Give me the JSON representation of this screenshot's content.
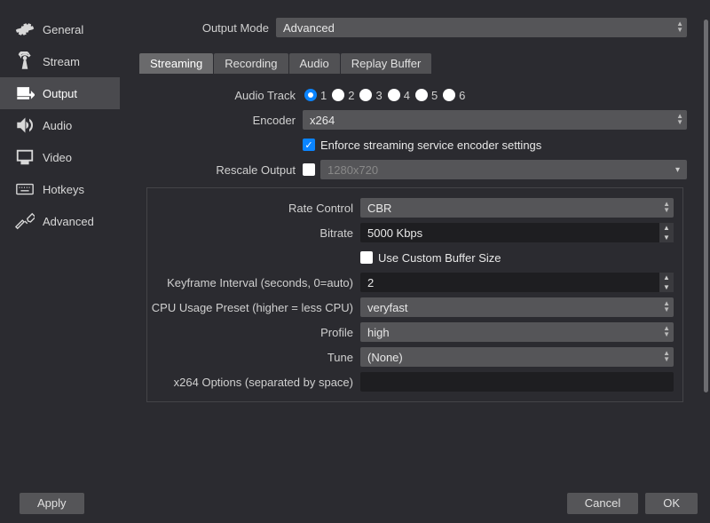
{
  "sidebar": {
    "items": [
      {
        "label": "General"
      },
      {
        "label": "Stream"
      },
      {
        "label": "Output"
      },
      {
        "label": "Audio"
      },
      {
        "label": "Video"
      },
      {
        "label": "Hotkeys"
      },
      {
        "label": "Advanced"
      }
    ]
  },
  "header": {
    "output_mode_label": "Output Mode",
    "output_mode_value": "Advanced"
  },
  "tabs": [
    {
      "label": "Streaming",
      "active": true
    },
    {
      "label": "Recording"
    },
    {
      "label": "Audio"
    },
    {
      "label": "Replay Buffer"
    }
  ],
  "form": {
    "audio_track_label": "Audio Track",
    "audio_tracks": [
      "1",
      "2",
      "3",
      "4",
      "5",
      "6"
    ],
    "audio_track_selected": "1",
    "encoder_label": "Encoder",
    "encoder_value": "x264",
    "enforce_checkbox_label": "Enforce streaming service encoder settings",
    "enforce_checked": true,
    "rescale_label": "Rescale Output",
    "rescale_checked": false,
    "rescale_placeholder": "1280x720"
  },
  "panel": {
    "rate_control_label": "Rate Control",
    "rate_control_value": "CBR",
    "bitrate_label": "Bitrate",
    "bitrate_value": "5000 Kbps",
    "custom_buffer_label": "Use Custom Buffer Size",
    "custom_buffer_checked": false,
    "keyframe_label": "Keyframe Interval (seconds, 0=auto)",
    "keyframe_value": "2",
    "cpu_preset_label": "CPU Usage Preset (higher = less CPU)",
    "cpu_preset_value": "veryfast",
    "profile_label": "Profile",
    "profile_value": "high",
    "tune_label": "Tune",
    "tune_value": "(None)",
    "x264_opts_label": "x264 Options (separated by space)",
    "x264_opts_value": ""
  },
  "footer": {
    "apply": "Apply",
    "cancel": "Cancel",
    "ok": "OK"
  }
}
